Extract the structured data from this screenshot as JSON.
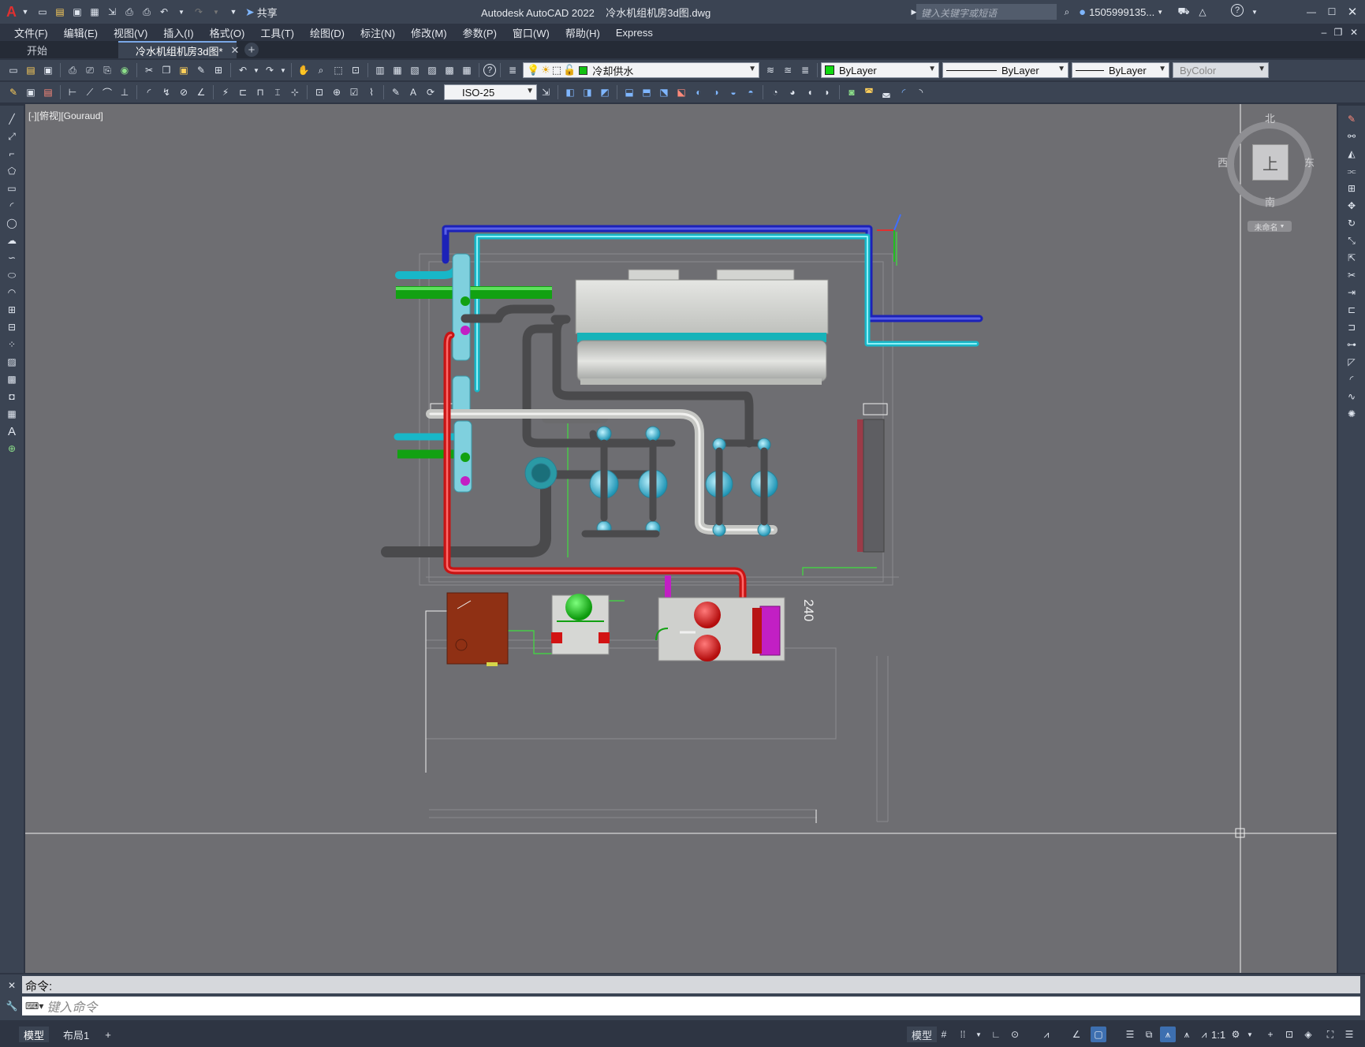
{
  "title_bar": {
    "app_logo": "A",
    "share_label": "共享",
    "window_title": "Autodesk AutoCAD 2022    冷水机组机房3d图.dwg",
    "search_placeholder": "键入关键字或短语",
    "user_name": "1505999135...",
    "help_label": "?"
  },
  "menu": [
    "文件(F)",
    "编辑(E)",
    "视图(V)",
    "插入(I)",
    "格式(O)",
    "工具(T)",
    "绘图(D)",
    "标注(N)",
    "修改(M)",
    "参数(P)",
    "窗口(W)",
    "帮助(H)",
    "Express"
  ],
  "tabs": {
    "start": "开始",
    "drawing": "冷水机组机房3d图*",
    "add": "+"
  },
  "toolbar": {
    "layer": "冷却供水",
    "color": "ByLayer",
    "linetype": "ByLayer",
    "lineweight": "ByLayer",
    "plotstyle": "ByColor",
    "dimstyle": "ISO-25"
  },
  "viewport": {
    "label": "[-][俯视][Gouraud]",
    "dim_text": "240",
    "viewcube": {
      "top": "上",
      "north": "北",
      "south": "南",
      "east": "东",
      "west": "西",
      "named": "未命名"
    }
  },
  "command": {
    "history": "命令:",
    "placeholder": "键入命令"
  },
  "status": {
    "model": "模型",
    "layout1": "布局1",
    "add": "+",
    "model_btn": "模型",
    "scale": "1:1"
  },
  "colors": {
    "accent": "#3b4453",
    "background": "#6e6e72",
    "chilled_supply": "#18b7c8",
    "cooling_supply": "#12a112",
    "return_blue": "#1c22b8",
    "red_pipe": "#c81414",
    "magenta_pipe": "#c21fc4"
  }
}
